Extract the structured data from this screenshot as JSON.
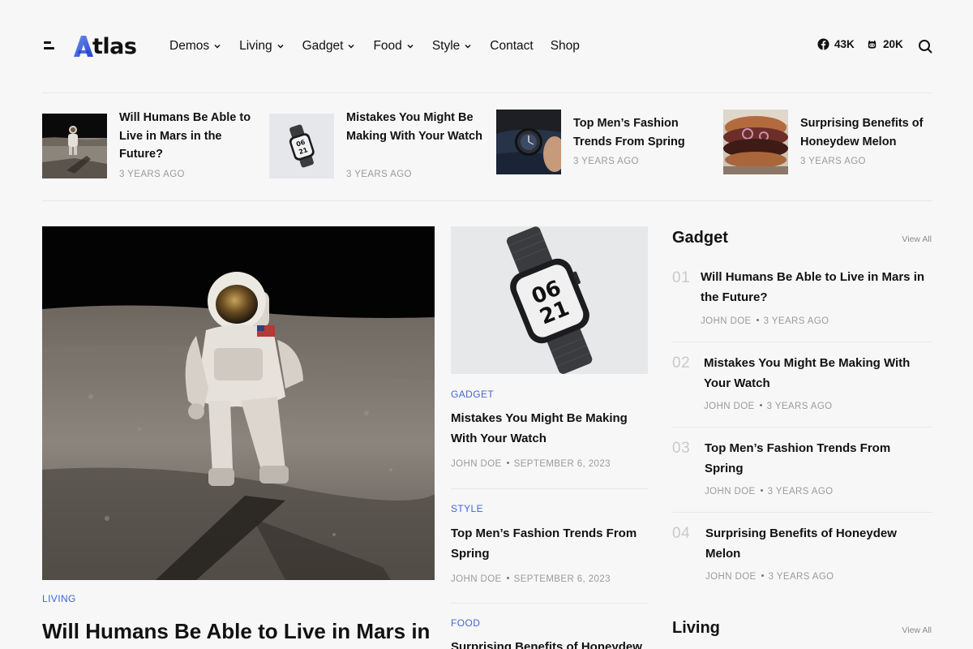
{
  "brand": {
    "name": "tlas",
    "accent": "#4166d5"
  },
  "nav": {
    "items": [
      {
        "label": "Demos",
        "dropdown": true
      },
      {
        "label": "Living",
        "dropdown": true
      },
      {
        "label": "Gadget",
        "dropdown": true
      },
      {
        "label": "Food",
        "dropdown": true
      },
      {
        "label": "Style",
        "dropdown": true
      },
      {
        "label": "Contact",
        "dropdown": false
      },
      {
        "label": "Shop",
        "dropdown": false
      }
    ]
  },
  "social": {
    "facebook": "43K",
    "github": "20K"
  },
  "strip": [
    {
      "title": "Will Humans Be Able to Live in Mars in the Future?",
      "meta": "3 YEARS AGO",
      "thumb": "astronaut"
    },
    {
      "title": "Mistakes You Might Be Making With Your Watch",
      "meta": "3 YEARS AGO",
      "thumb": "watch"
    },
    {
      "title": "Top Men’s Fashion Trends From Spring",
      "meta": "3 YEARS AGO",
      "thumb": "wrist-watch"
    },
    {
      "title": "Surprising Benefits of Honeydew Melon",
      "meta": "3 YEARS AGO",
      "thumb": "burger"
    }
  ],
  "hero": {
    "category": "LIVING",
    "title": "Will Humans Be Able to Live in Mars in"
  },
  "middle": {
    "watch_face": {
      "line1": "06",
      "line2": "21"
    },
    "posts": [
      {
        "category": "GADGET",
        "title": "Mistakes You Might Be Making With Your Watch",
        "author": "JOHN DOE",
        "date": "SEPTEMBER 6, 2023"
      },
      {
        "category": "STYLE",
        "title": "Top Men’s Fashion Trends From Spring",
        "author": "JOHN DOE",
        "date": "SEPTEMBER 6, 2023"
      },
      {
        "category": "FOOD",
        "title": "Surprising Benefits of Honeydew"
      }
    ]
  },
  "sidebar": {
    "gadget": {
      "heading": "Gadget",
      "view_all": "View All",
      "items": [
        {
          "num": "01",
          "title": "Will Humans Be Able to Live in Mars in the Future?",
          "author": "JOHN DOE",
          "time": "3 YEARS AGO"
        },
        {
          "num": "02",
          "title": "Mistakes You Might Be Making With Your Watch",
          "author": "JOHN DOE",
          "time": "3 YEARS AGO"
        },
        {
          "num": "03",
          "title": "Top Men’s Fashion Trends From Spring",
          "author": "JOHN DOE",
          "time": "3 YEARS AGO"
        },
        {
          "num": "04",
          "title": "Surprising Benefits of Honeydew Melon",
          "author": "JOHN DOE",
          "time": "3 YEARS AGO"
        }
      ]
    },
    "living": {
      "heading": "Living",
      "view_all": "View All"
    }
  }
}
